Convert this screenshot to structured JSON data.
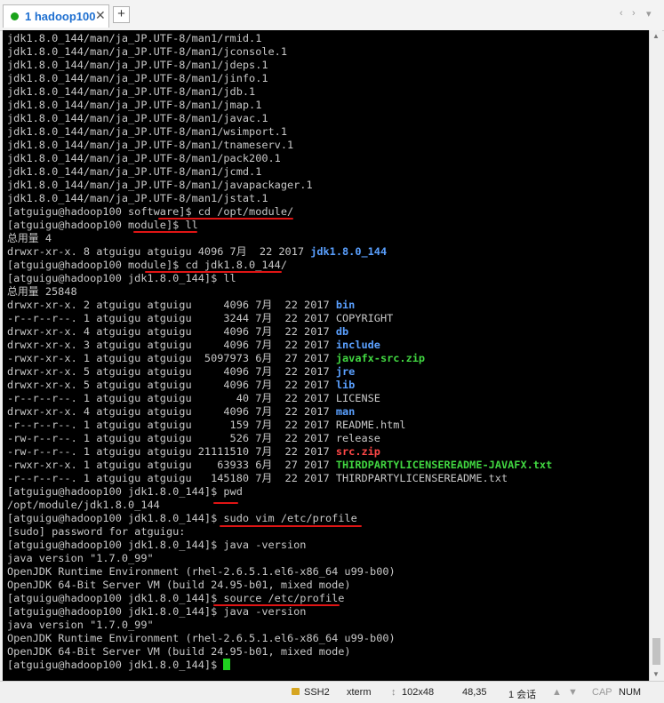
{
  "tab": {
    "title": "1 hadoop100",
    "close": "✕",
    "add": "+",
    "nav_left": "‹",
    "nav_right": "›",
    "nav_menu": "▾"
  },
  "terminal": {
    "lines": [
      [
        {
          "t": "jdk1.8.0_144/man/ja_JP.UTF-8/man1/rmid.1"
        }
      ],
      [
        {
          "t": "jdk1.8.0_144/man/ja_JP.UTF-8/man1/jconsole.1"
        }
      ],
      [
        {
          "t": "jdk1.8.0_144/man/ja_JP.UTF-8/man1/jdeps.1"
        }
      ],
      [
        {
          "t": "jdk1.8.0_144/man/ja_JP.UTF-8/man1/jinfo.1"
        }
      ],
      [
        {
          "t": "jdk1.8.0_144/man/ja_JP.UTF-8/man1/jdb.1"
        }
      ],
      [
        {
          "t": "jdk1.8.0_144/man/ja_JP.UTF-8/man1/jmap.1"
        }
      ],
      [
        {
          "t": "jdk1.8.0_144/man/ja_JP.UTF-8/man1/javac.1"
        }
      ],
      [
        {
          "t": "jdk1.8.0_144/man/ja_JP.UTF-8/man1/wsimport.1"
        }
      ],
      [
        {
          "t": "jdk1.8.0_144/man/ja_JP.UTF-8/man1/tnameserv.1"
        }
      ],
      [
        {
          "t": "jdk1.8.0_144/man/ja_JP.UTF-8/man1/pack200.1"
        }
      ],
      [
        {
          "t": "jdk1.8.0_144/man/ja_JP.UTF-8/man1/jcmd.1"
        }
      ],
      [
        {
          "t": "jdk1.8.0_144/man/ja_JP.UTF-8/man1/javapackager.1"
        }
      ],
      [
        {
          "t": "jdk1.8.0_144/man/ja_JP.UTF-8/man1/jstat.1"
        }
      ],
      [
        {
          "t": "[atguigu@hadoop100 software]$ cd /opt/module/"
        }
      ],
      [
        {
          "t": "[atguigu@hadoop100 module]$ ll"
        }
      ],
      [
        {
          "t": "总用量 4"
        }
      ],
      [
        {
          "t": "drwxr-xr-x. 8 atguigu atguigu 4096 7月  22 2017 "
        },
        {
          "t": "jdk1.8.0_144",
          "c": "c-blue"
        }
      ],
      [
        {
          "t": "[atguigu@hadoop100 module]$ cd jdk1.8.0_144/"
        }
      ],
      [
        {
          "t": "[atguigu@hadoop100 jdk1.8.0_144]$ ll"
        }
      ],
      [
        {
          "t": "总用量 25848"
        }
      ],
      [
        {
          "t": "drwxr-xr-x. 2 atguigu atguigu     4096 7月  22 2017 "
        },
        {
          "t": "bin",
          "c": "c-blue"
        }
      ],
      [
        {
          "t": "-r--r--r--. 1 atguigu atguigu     3244 7月  22 2017 COPYRIGHT"
        }
      ],
      [
        {
          "t": "drwxr-xr-x. 4 atguigu atguigu     4096 7月  22 2017 "
        },
        {
          "t": "db",
          "c": "c-blue"
        }
      ],
      [
        {
          "t": "drwxr-xr-x. 3 atguigu atguigu     4096 7月  22 2017 "
        },
        {
          "t": "include",
          "c": "c-blue"
        }
      ],
      [
        {
          "t": "-rwxr-xr-x. 1 atguigu atguigu  5097973 6月  27 2017 "
        },
        {
          "t": "javafx-src.zip",
          "c": "c-green"
        }
      ],
      [
        {
          "t": "drwxr-xr-x. 5 atguigu atguigu     4096 7月  22 2017 "
        },
        {
          "t": "jre",
          "c": "c-blue"
        }
      ],
      [
        {
          "t": "drwxr-xr-x. 5 atguigu atguigu     4096 7月  22 2017 "
        },
        {
          "t": "lib",
          "c": "c-blue"
        }
      ],
      [
        {
          "t": "-r--r--r--. 1 atguigu atguigu       40 7月  22 2017 LICENSE"
        }
      ],
      [
        {
          "t": "drwxr-xr-x. 4 atguigu atguigu     4096 7月  22 2017 "
        },
        {
          "t": "man",
          "c": "c-blue"
        }
      ],
      [
        {
          "t": "-r--r--r--. 1 atguigu atguigu      159 7月  22 2017 README.html"
        }
      ],
      [
        {
          "t": "-rw-r--r--. 1 atguigu atguigu      526 7月  22 2017 release"
        }
      ],
      [
        {
          "t": "-rw-r--r--. 1 atguigu atguigu 21111510 7月  22 2017 "
        },
        {
          "t": "src.zip",
          "c": "c-red"
        }
      ],
      [
        {
          "t": "-rwxr-xr-x. 1 atguigu atguigu    63933 6月  27 2017 "
        },
        {
          "t": "THIRDPARTYLICENSEREADME-JAVAFX.txt",
          "c": "c-green"
        }
      ],
      [
        {
          "t": "-r--r--r--. 1 atguigu atguigu   145180 7月  22 2017 THIRDPARTYLICENSEREADME.txt"
        }
      ],
      [
        {
          "t": "[atguigu@hadoop100 jdk1.8.0_144]$ pwd"
        }
      ],
      [
        {
          "t": "/opt/module/jdk1.8.0_144"
        }
      ],
      [
        {
          "t": "[atguigu@hadoop100 jdk1.8.0_144]$ sudo vim /etc/profile"
        }
      ],
      [
        {
          "t": "[sudo] password for atguigu:"
        }
      ],
      [
        {
          "t": "[atguigu@hadoop100 jdk1.8.0_144]$ java -version"
        }
      ],
      [
        {
          "t": "java version \"1.7.0_99\""
        }
      ],
      [
        {
          "t": "OpenJDK Runtime Environment (rhel-2.6.5.1.el6-x86_64 u99-b00)"
        }
      ],
      [
        {
          "t": "OpenJDK 64-Bit Server VM (build 24.95-b01, mixed mode)"
        }
      ],
      [
        {
          "t": "[atguigu@hadoop100 jdk1.8.0_144]$ source /etc/profile"
        }
      ],
      [
        {
          "t": "[atguigu@hadoop100 jdk1.8.0_144]$ java -version"
        }
      ],
      [
        {
          "t": "java version \"1.7.0_99\""
        }
      ],
      [
        {
          "t": "OpenJDK Runtime Environment (rhel-2.6.5.1.el6-x86_64 u99-b00)"
        }
      ],
      [
        {
          "t": "OpenJDK 64-Bit Server VM (build 24.95-b01, mixed mode)"
        }
      ],
      [
        {
          "t": "[atguigu@hadoop100 jdk1.8.0_144]$ "
        },
        {
          "cursor": true
        }
      ]
    ],
    "colors": {
      "background": "#000000",
      "text": "#c8c8c8",
      "dir": "#5aa0ff",
      "exec": "#41d641",
      "archive": "#ff4747",
      "annotation": "#e01414"
    }
  },
  "status": {
    "protocol": "SSH2",
    "term_type": "xterm",
    "size": "102x48",
    "cursor_pos": "48,35",
    "sessions": "1 会话",
    "up": "▲",
    "down": "▼",
    "caps": "CAP",
    "num": "NUM"
  }
}
